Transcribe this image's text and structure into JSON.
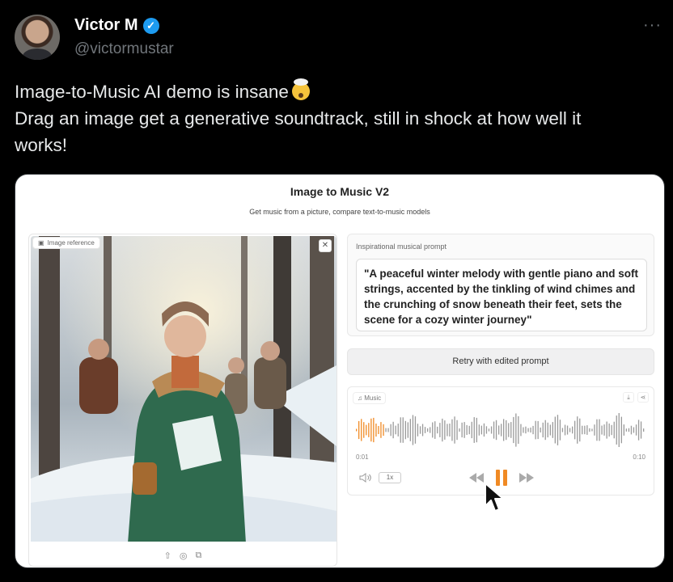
{
  "tweet": {
    "display_name": "Victor M",
    "handle": "@victormustar",
    "more": "···",
    "verified_mark": "✓",
    "lines": [
      "Image-to-Music AI demo is insane",
      "Drag an image get a generative soundtrack, still in shock at how well it",
      "works!"
    ]
  },
  "app": {
    "title": "Image to Music V2",
    "subtitle": "Get music from a picture, compare text-to-music models",
    "image_label": "Image reference",
    "close": "✕",
    "image_tools": [
      "⇧",
      "◎",
      "⧉"
    ],
    "prompt_label": "Inspirational musical prompt",
    "prompt_text": "\"A peaceful winter melody with gentle piano and soft strings, accented by the tinkling of wind chimes and the crunching of snow beneath their feet, sets the scene for a cozy winter journey\"",
    "retry_label": "Retry with edited prompt",
    "music_label": "Music",
    "music_actions": [
      "⤓",
      "⋖"
    ],
    "time_start": "0:01",
    "time_end": "0:10",
    "speed": "1x"
  },
  "player": {
    "progress_fraction": 0.1
  },
  "colors": {
    "accent": "#f08a24",
    "verified": "#1d9bf0"
  }
}
